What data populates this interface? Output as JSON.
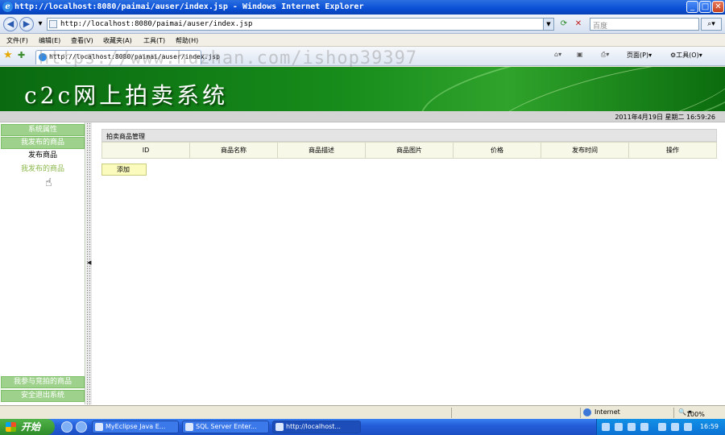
{
  "window": {
    "title": "http://localhost:8080/paimai/auser/index.jsp - Windows Internet Explorer",
    "minimize": "_",
    "maximize": "□",
    "close": "✕"
  },
  "address_bar": {
    "url": "http://localhost:8080/paimai/auser/index.jsp",
    "search_placeholder": "百度",
    "back_icon": "back-arrow-icon",
    "forward_icon": "forward-arrow-icon",
    "refresh_icon": "refresh-icon",
    "stop_icon": "stop-icon",
    "search_icon": "search-icon"
  },
  "menubar": {
    "items": [
      "文件(F)",
      "编辑(E)",
      "查看(V)",
      "收藏夹(A)",
      "工具(T)",
      "帮助(H)"
    ]
  },
  "tabrow": {
    "tab_title": "http://localhost:8080/paimai/auser/index.jsp",
    "page_menu": "页面(P)",
    "tools_menu": "工具(O)"
  },
  "watermark": "https://www.huzhan.com/ishop39397",
  "banner": {
    "title": "c2c网上拍卖系统"
  },
  "datebar": {
    "datetime": "2011年4月19日 星期二 16:59:26"
  },
  "sidebar": {
    "system_properties": "系统属性",
    "my_items_header": "我发布的商品",
    "publish_item": "发布商品",
    "my_published_items": "我发布的商品",
    "my_bids": "我参与竞拍的商品",
    "logout": "安全退出系统"
  },
  "main": {
    "panel_title": "拍卖商品管理",
    "columns": [
      "ID",
      "商品名称",
      "商品描述",
      "商品图片",
      "价格",
      "发布时间",
      "操作"
    ],
    "add_button": "添加"
  },
  "statusbar": {
    "zone": "Internet",
    "zoom": "100%"
  },
  "taskbar": {
    "start": "开始",
    "tasks": [
      "MyEclipse Java E...",
      "SQL Server Enter...",
      "http://localhost..."
    ],
    "clock": "16:59"
  }
}
